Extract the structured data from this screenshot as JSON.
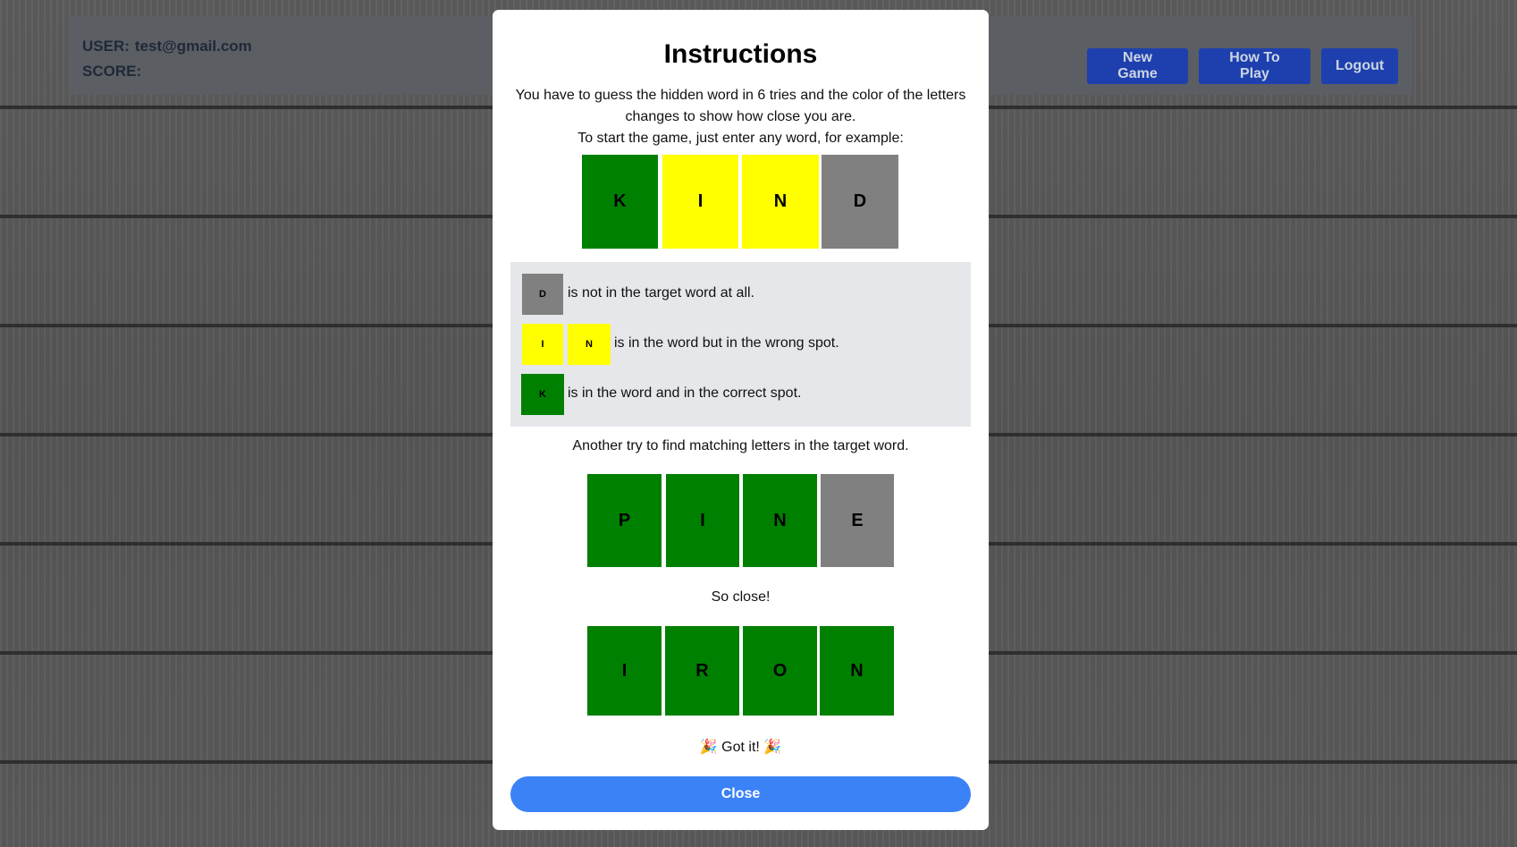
{
  "header": {
    "user_label": "USER:",
    "user_email": "test@gmail.com",
    "score_label": "SCORE:",
    "buttons": {
      "new_game": "New Game",
      "how_to_play": "How To Play",
      "logout": "Logout"
    }
  },
  "modal": {
    "title": "Instructions",
    "intro_line1": "You have to guess the hidden word in 6 tries and the color of the letters",
    "intro_line2": "changes to show how close you are.",
    "intro_line3": "To start the game, just enter any word, for example:",
    "example1": [
      "K",
      "I",
      "N",
      "D"
    ],
    "legend": {
      "gray_letter": "D",
      "gray_text": "is not in the target word at all.",
      "yellow_letters": [
        "I",
        "N"
      ],
      "yellow_text": "is in the word but in the wrong spot.",
      "green_letter": "K",
      "green_text": "is in the word and in the correct spot."
    },
    "another_try_text": "Another try to find matching letters in the target word.",
    "example2": [
      "P",
      "I",
      "N",
      "E"
    ],
    "so_close_text": "So close!",
    "example3": [
      "I",
      "R",
      "O",
      "N"
    ],
    "got_it_text": "Got it!",
    "close_label": "Close"
  },
  "colors": {
    "correct": "#008000",
    "present": "#ffff00",
    "absent": "#808080",
    "header_button": "#1e40af",
    "close_button": "#3b82f6"
  }
}
